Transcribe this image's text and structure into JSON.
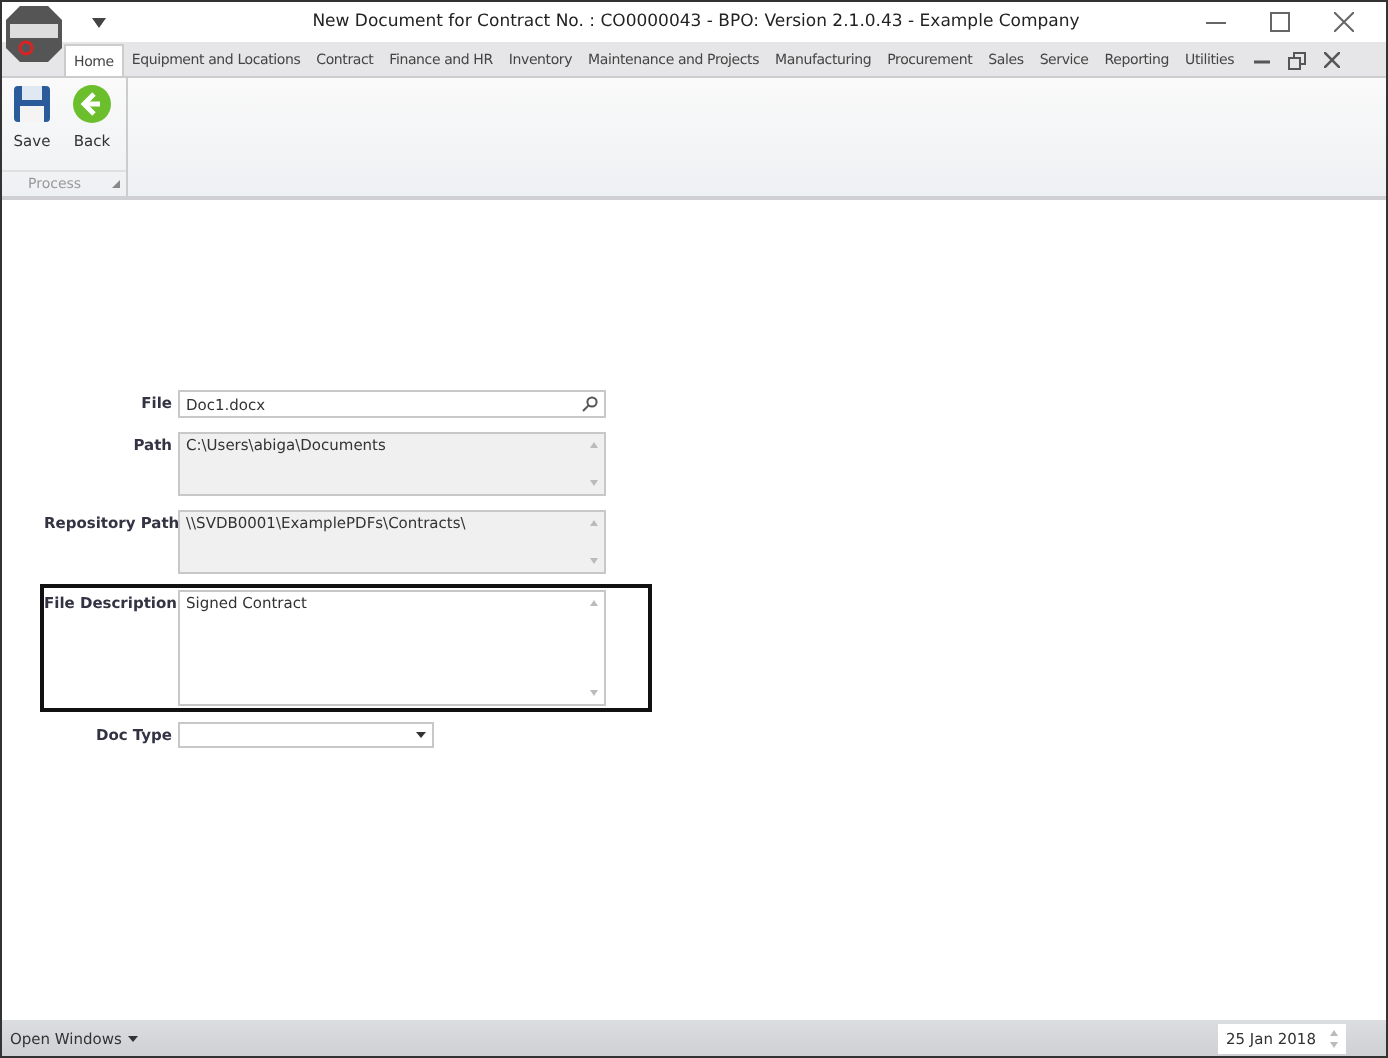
{
  "window": {
    "title": "New Document for Contract No. : CO0000043 - BPO: Version 2.1.0.43 - Example Company"
  },
  "tabs": [
    {
      "label": "Home",
      "selected": true
    },
    {
      "label": "Equipment and Locations",
      "selected": false
    },
    {
      "label": "Contract",
      "selected": false
    },
    {
      "label": "Finance and HR",
      "selected": false
    },
    {
      "label": "Inventory",
      "selected": false
    },
    {
      "label": "Maintenance and Projects",
      "selected": false
    },
    {
      "label": "Manufacturing",
      "selected": false
    },
    {
      "label": "Procurement",
      "selected": false
    },
    {
      "label": "Sales",
      "selected": false
    },
    {
      "label": "Service",
      "selected": false
    },
    {
      "label": "Reporting",
      "selected": false
    },
    {
      "label": "Utilities",
      "selected": false
    }
  ],
  "ribbon": {
    "buttons": [
      {
        "label": "Save",
        "kind": "save"
      },
      {
        "label": "Back",
        "kind": "back"
      }
    ],
    "group_label": "Process"
  },
  "form": {
    "fields": [
      {
        "label": "File",
        "kind": "search",
        "value": "Doc1.docx",
        "highlighted": false
      },
      {
        "label": "Path",
        "kind": "memo",
        "value": "C:\\Users\\abiga\\Documents",
        "readonly": true,
        "highlighted": false
      },
      {
        "label": "Repository Path",
        "kind": "memo",
        "value": "\\\\SVDB0001\\ExamplePDFs\\Contracts\\",
        "readonly": true,
        "highlighted": false
      },
      {
        "label": "File Description",
        "kind": "memo",
        "value": "Signed Contract",
        "readonly": false,
        "highlighted": true,
        "tall": true
      },
      {
        "label": "Doc Type",
        "kind": "dropdown",
        "highlighted": false
      }
    ]
  },
  "status_bar": {
    "open_windows": "Open Windows",
    "date": "25 Jan 2018"
  }
}
